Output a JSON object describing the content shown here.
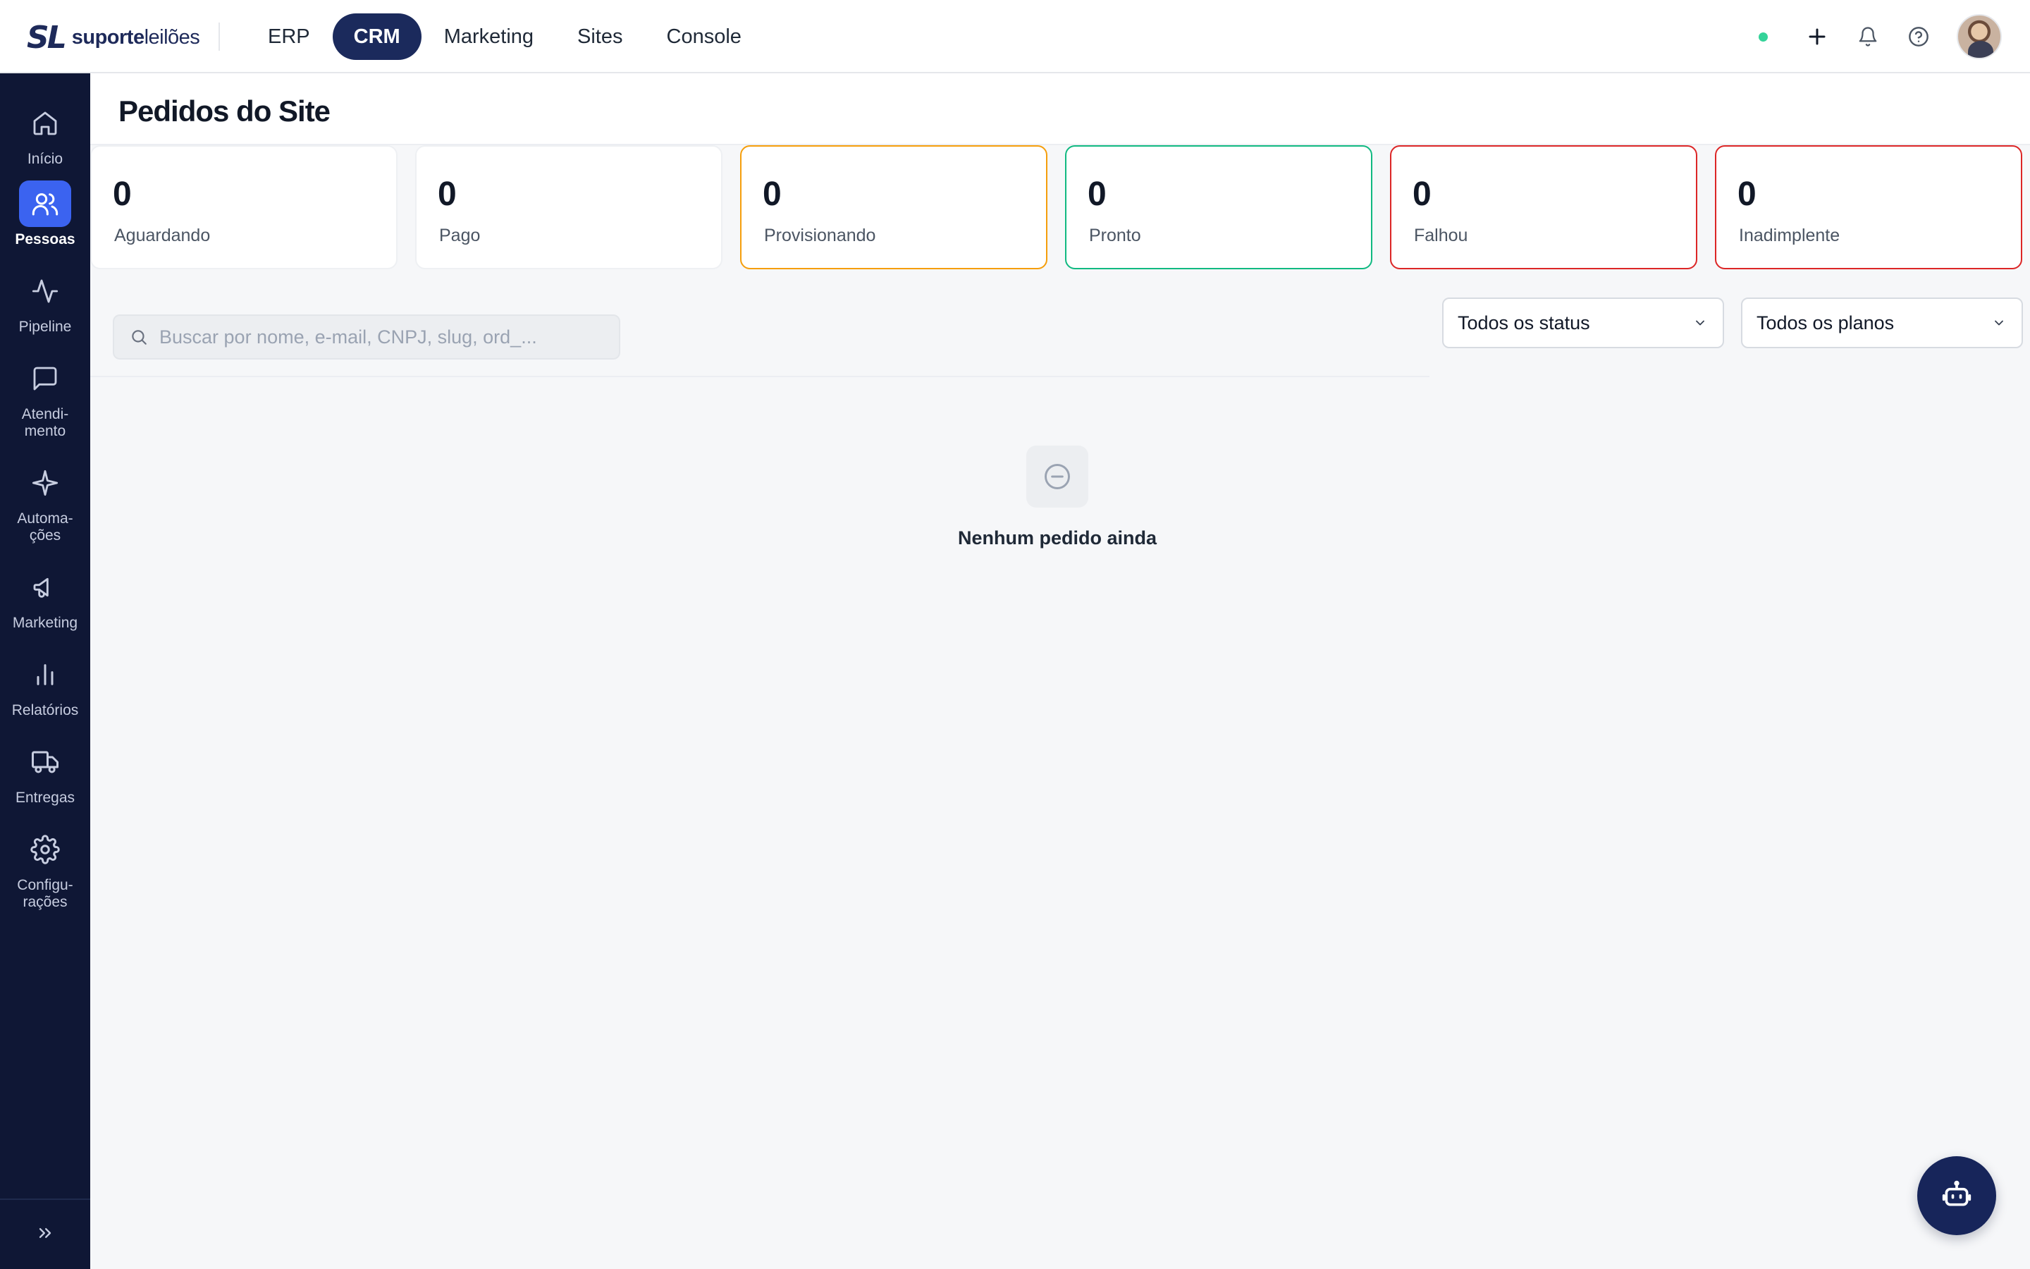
{
  "app": {
    "logo_mark": "SL",
    "logo_bold": "suporte",
    "logo_light": "leilões"
  },
  "topnav": {
    "items": [
      {
        "label": "ERP"
      },
      {
        "label": "CRM"
      },
      {
        "label": "Marketing"
      },
      {
        "label": "Sites"
      },
      {
        "label": "Console"
      }
    ],
    "active": "CRM"
  },
  "topbar_icons": [
    "status-online-dot",
    "plus-icon",
    "bell-icon",
    "help-circle-icon",
    "user-avatar"
  ],
  "sidebar": {
    "items": [
      {
        "label": "Início",
        "icon": "home-icon"
      },
      {
        "label": "Pessoas",
        "icon": "users-icon"
      },
      {
        "label": "Pipeline",
        "icon": "activity-icon"
      },
      {
        "label": "Atendi-\nmento",
        "icon": "message-square-icon"
      },
      {
        "label": "Automa-\nções",
        "icon": "sparkle-icon"
      },
      {
        "label": "Marketing",
        "icon": "megaphone-icon"
      },
      {
        "label": "Relatórios",
        "icon": "bar-chart-icon"
      },
      {
        "label": "Entregas",
        "icon": "truck-icon"
      },
      {
        "label": "Configu-\nrações",
        "icon": "gear-icon"
      }
    ],
    "active": "Pessoas",
    "expand_icon": "chevrons-right-icon"
  },
  "page": {
    "title": "Pedidos do Site"
  },
  "stats": [
    {
      "value": "0",
      "label": "Aguardando"
    },
    {
      "value": "0",
      "label": "Pago"
    },
    {
      "value": "0",
      "label": "Provisionando"
    },
    {
      "value": "0",
      "label": "Pronto"
    },
    {
      "value": "0",
      "label": "Falhou"
    },
    {
      "value": "0",
      "label": "Inadimplente"
    }
  ],
  "colors": {
    "brand_navy": "#1b2a5c",
    "sidebar_bg": "#0f1735",
    "active_blue": "#3b63f0",
    "provisioning": "#f59e0b",
    "ready": "#10b981",
    "failed": "#dc2626",
    "online": "#34d399"
  },
  "search": {
    "placeholder": "Buscar por nome, e-mail, CNPJ, slug, ord_...",
    "value": ""
  },
  "filters": {
    "status": "Todos os status",
    "plans": "Todos os planos"
  },
  "empty_state": {
    "icon": "minus-circle-icon",
    "message": "Nenhum pedido ainda"
  },
  "fab": {
    "icon": "bot-icon"
  }
}
